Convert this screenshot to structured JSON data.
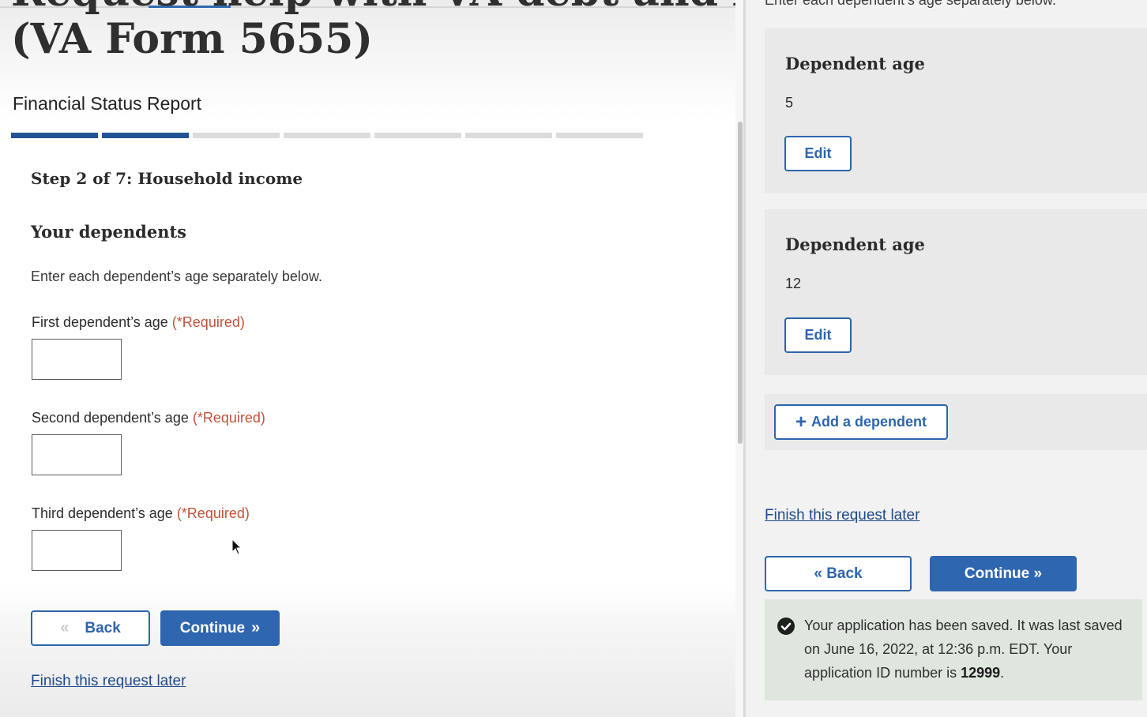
{
  "form": {
    "title_line1": "Request help with VA debt and bills",
    "title_line2": "(VA Form 5655)",
    "subtitle": "Financial Status Report",
    "progress": {
      "current_step": 2,
      "total_steps": 7
    },
    "step_title": "Step 2 of 7: Household income",
    "section_title": "Your dependents",
    "instruction": "Enter each dependent’s age separately below.",
    "required_text": "(*Required)",
    "fields": [
      {
        "label": "First dependent’s age",
        "value": ""
      },
      {
        "label": "Second dependent’s age",
        "value": ""
      },
      {
        "label": "Third dependent’s age",
        "value": ""
      }
    ],
    "back_label": "Back",
    "continue_label": "Continue",
    "finish_later": "Finish this request later"
  },
  "review": {
    "instruction": "Enter each dependent’s age separately below.",
    "dependents": [
      {
        "title": "Dependent age",
        "value": "5",
        "edit_label": "Edit"
      },
      {
        "title": "Dependent age",
        "value": "12",
        "edit_label": "Edit"
      }
    ],
    "add_label": "Add a dependent",
    "finish_later": "Finish this request later",
    "back_label": "« Back",
    "continue_label": "Continue »",
    "saved_message_part1": "Your application has been saved. It was last saved on June 16, 2022, at 12:36 p.m. EDT. Your application ID number is ",
    "saved_id": "12999",
    "saved_message_end": "."
  },
  "icons": {
    "back_chevron": "double-chevron-left-icon",
    "continue_chevron": "double-chevron-right-icon",
    "add": "plus-icon",
    "success": "check-circle-icon",
    "cursor": "mouse-pointer-icon"
  },
  "colors": {
    "primary": "#2f66b0",
    "progress_done": "#205493",
    "required": "#c0533a",
    "success_bg": "#dfe6de"
  }
}
